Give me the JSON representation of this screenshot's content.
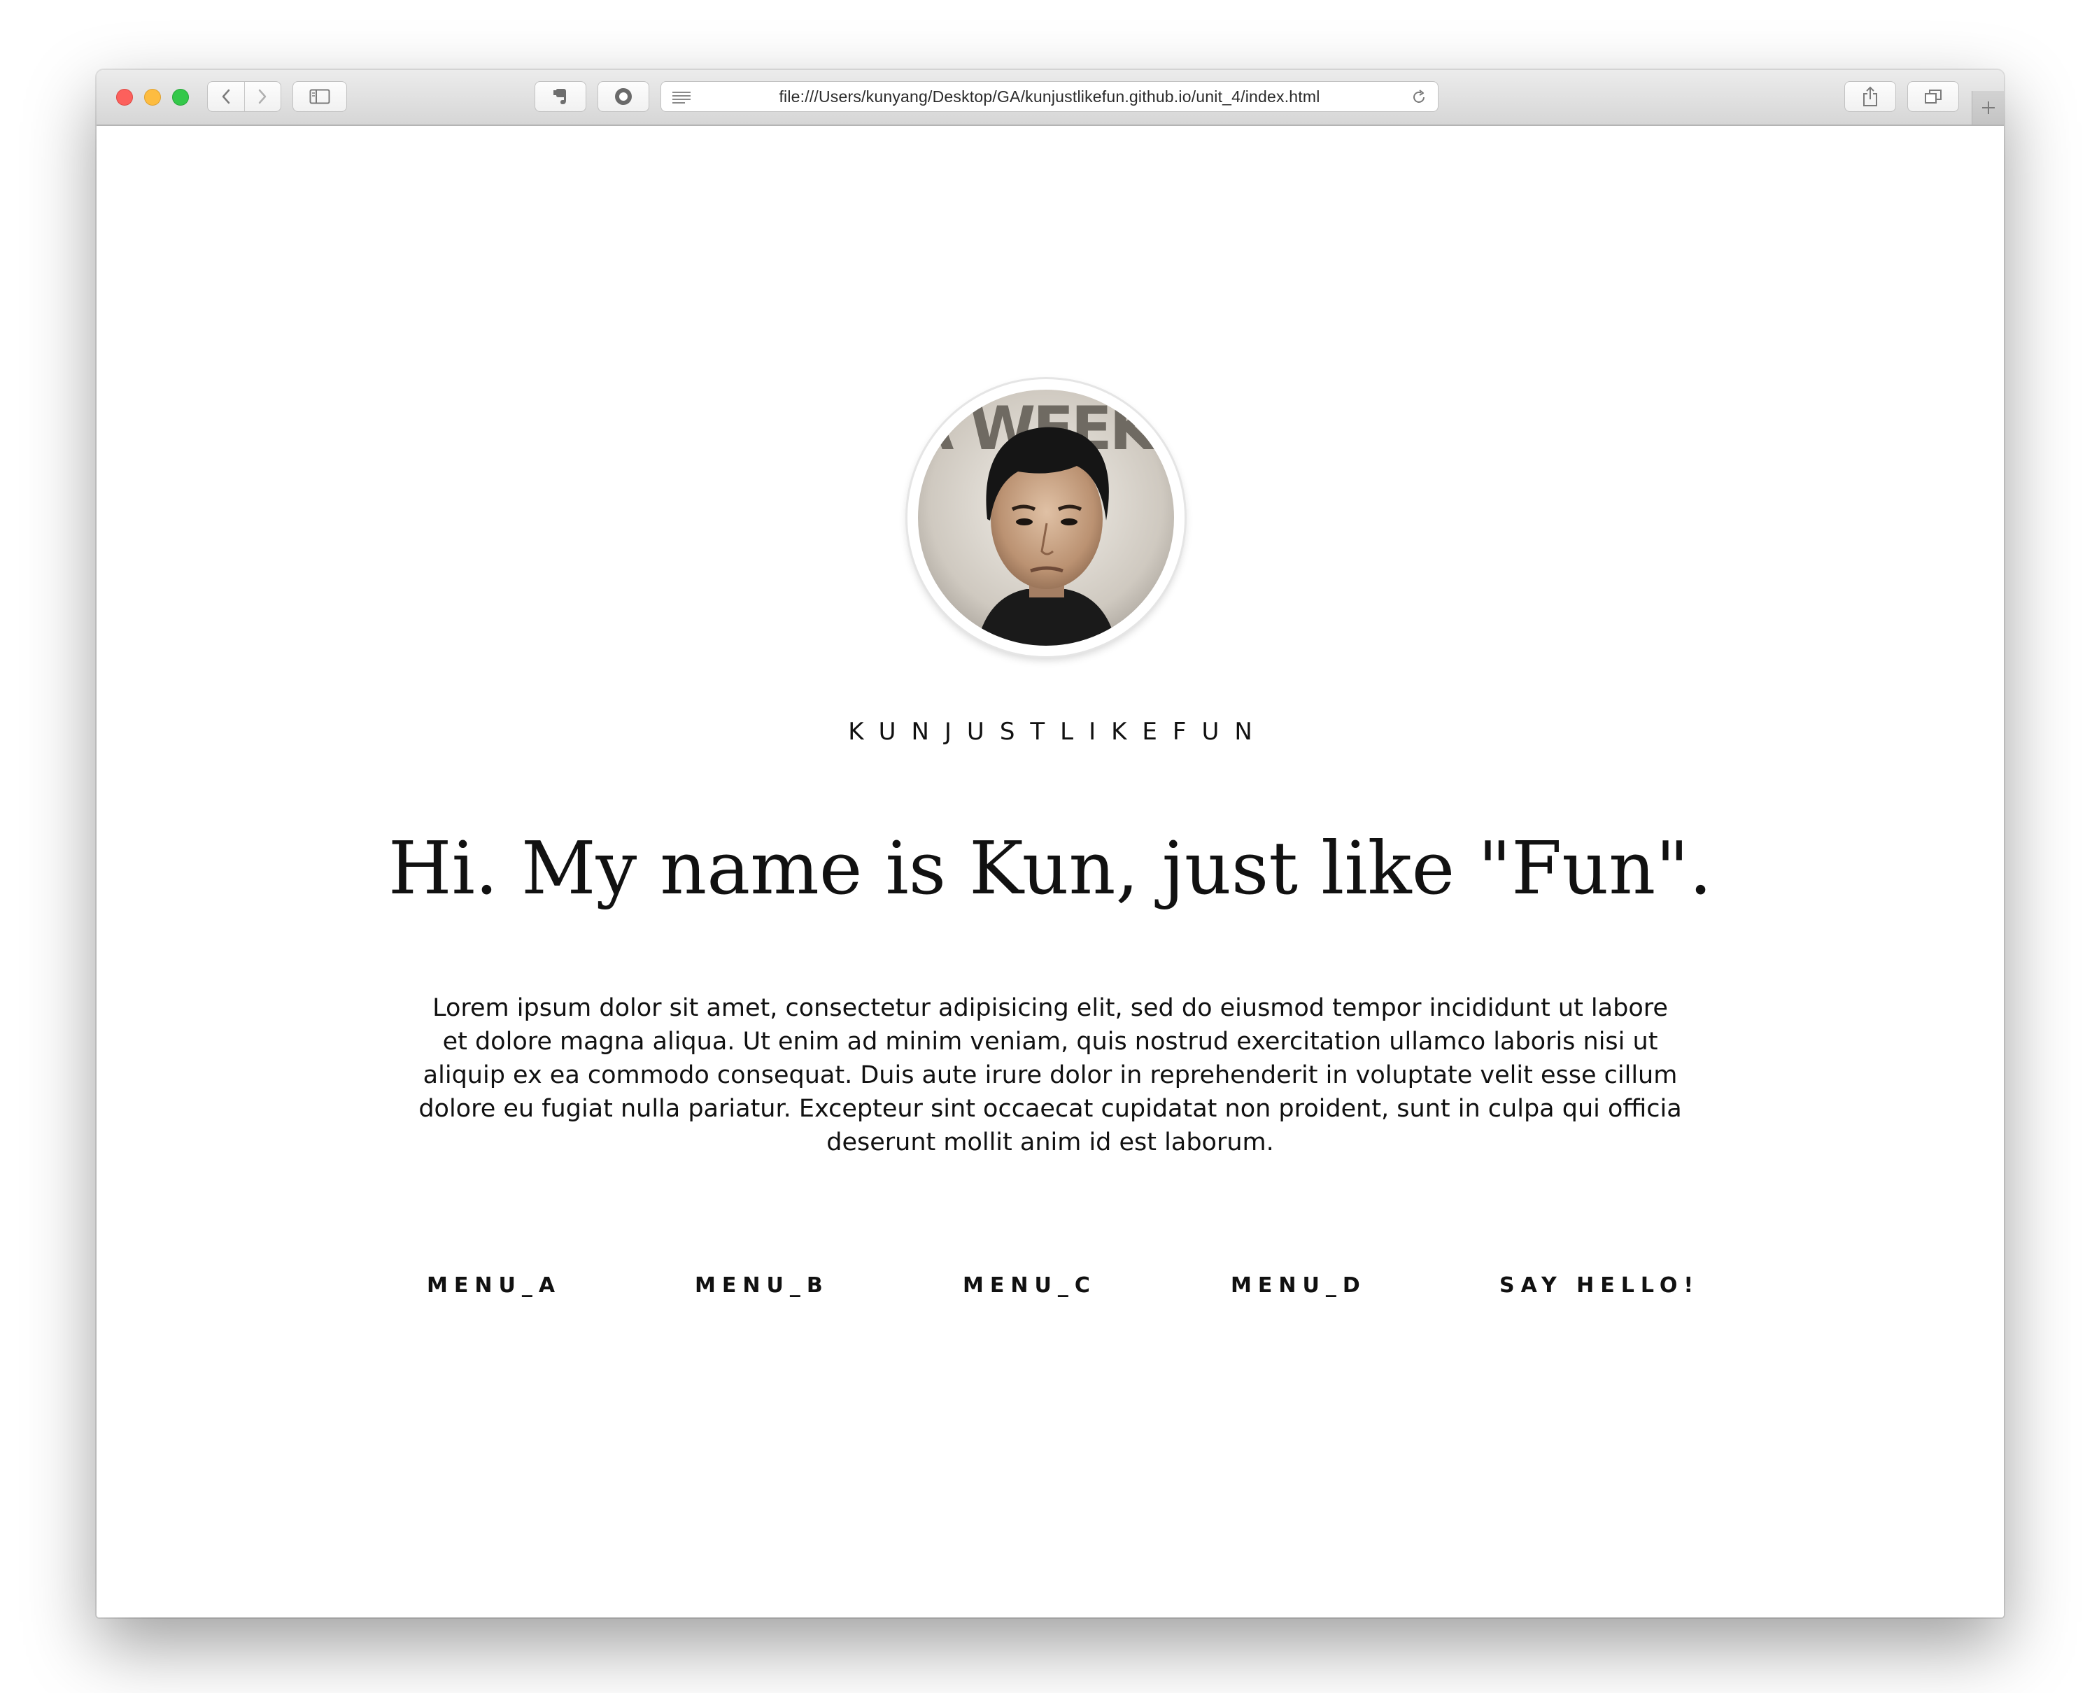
{
  "browser": {
    "url": "file:///Users/kunyang/Desktop/GA/kunjustlikefun.github.io/unit_4/index.html"
  },
  "page": {
    "brand": "KUNJUSTLIKEFUN",
    "headline": "Hi. My name is Kun, just like \"Fun\".",
    "intro": "Lorem ipsum dolor sit amet, consectetur adipisicing elit, sed do eiusmod tempor incididunt ut labore et dolore magna aliqua. Ut enim ad minim veniam, quis nostrud exercitation ullamco laboris nisi ut aliquip ex ea commodo consequat. Duis aute irure dolor in reprehenderit in voluptate velit esse cillum dolore eu fugiat nulla pariatur. Excepteur sint occaecat cupidatat non proident, sunt in culpa qui officia deserunt mollit anim id est laborum.",
    "avatar_backdrop_text": "LA WEEKLY",
    "menu": [
      "MENU_A",
      "MENU_B",
      "MENU_C",
      "MENU_D",
      "SAY HELLO!"
    ]
  }
}
